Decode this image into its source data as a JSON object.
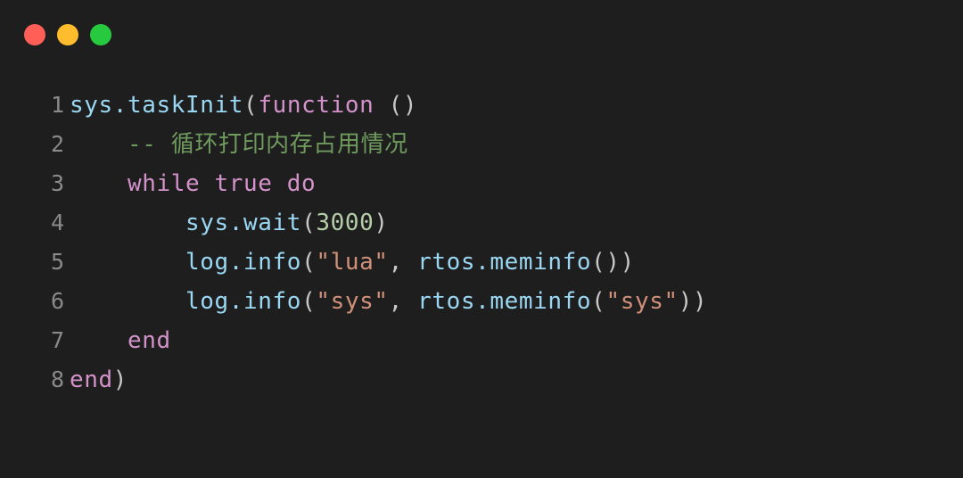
{
  "window": {
    "titlebar": {
      "buttons": [
        {
          "name": "close-button",
          "icon": "circle-icon",
          "color": "#ff5f56",
          "label": ""
        },
        {
          "name": "minimize-button",
          "icon": "circle-icon",
          "color": "#ffbd2e",
          "label": ""
        },
        {
          "name": "maximize-button",
          "icon": "circle-icon",
          "color": "#27c93f",
          "label": ""
        }
      ]
    },
    "background_color": "#1e1e1e"
  },
  "editor": {
    "language": "lua",
    "theme_colors": {
      "background": "#1e1e1e",
      "gutter": "#8a8a8a",
      "identifier": "#9ad7f2",
      "keyword": "#d392c9",
      "comment": "#6f9a5d",
      "string": "#d0907a",
      "number": "#b5cea8",
      "punctuation": "#c8c8c8"
    },
    "lines": [
      {
        "number": "1",
        "text": "sys.taskInit(function ()",
        "tokens": [
          {
            "text": "sys.taskInit",
            "type": "ident"
          },
          {
            "text": "(",
            "type": "punct"
          },
          {
            "text": "function",
            "type": "keyword"
          },
          {
            "text": " ()",
            "type": "punct"
          }
        ]
      },
      {
        "number": "2",
        "text": "    -- 循环打印内存占用情况",
        "tokens": [
          {
            "text": "    ",
            "type": "plain"
          },
          {
            "text": "-- 循环打印内存占用情况",
            "type": "comment"
          }
        ]
      },
      {
        "number": "3",
        "text": "    while true do",
        "tokens": [
          {
            "text": "    ",
            "type": "plain"
          },
          {
            "text": "while true do",
            "type": "keyword"
          }
        ]
      },
      {
        "number": "4",
        "text": "        sys.wait(3000)",
        "tokens": [
          {
            "text": "        ",
            "type": "plain"
          },
          {
            "text": "sys.wait",
            "type": "ident"
          },
          {
            "text": "(",
            "type": "punct"
          },
          {
            "text": "3000",
            "type": "number"
          },
          {
            "text": ")",
            "type": "punct"
          }
        ]
      },
      {
        "number": "5",
        "text": "        log.info(\"lua\", rtos.meminfo())",
        "tokens": [
          {
            "text": "        ",
            "type": "plain"
          },
          {
            "text": "log.info",
            "type": "ident"
          },
          {
            "text": "(",
            "type": "punct"
          },
          {
            "text": "\"lua\"",
            "type": "string"
          },
          {
            "text": ", ",
            "type": "punct"
          },
          {
            "text": "rtos.meminfo",
            "type": "ident"
          },
          {
            "text": "())",
            "type": "punct"
          }
        ]
      },
      {
        "number": "6",
        "text": "        log.info(\"sys\", rtos.meminfo(\"sys\"))",
        "tokens": [
          {
            "text": "        ",
            "type": "plain"
          },
          {
            "text": "log.info",
            "type": "ident"
          },
          {
            "text": "(",
            "type": "punct"
          },
          {
            "text": "\"sys\"",
            "type": "string"
          },
          {
            "text": ", ",
            "type": "punct"
          },
          {
            "text": "rtos.meminfo",
            "type": "ident"
          },
          {
            "text": "(",
            "type": "punct"
          },
          {
            "text": "\"sys\"",
            "type": "string"
          },
          {
            "text": "))",
            "type": "punct"
          }
        ]
      },
      {
        "number": "7",
        "text": "    end",
        "tokens": [
          {
            "text": "    ",
            "type": "plain"
          },
          {
            "text": "end",
            "type": "keyword"
          }
        ]
      },
      {
        "number": "8",
        "text": "end)",
        "tokens": [
          {
            "text": "end",
            "type": "keyword"
          },
          {
            "text": ")",
            "type": "punct"
          }
        ]
      }
    ]
  }
}
